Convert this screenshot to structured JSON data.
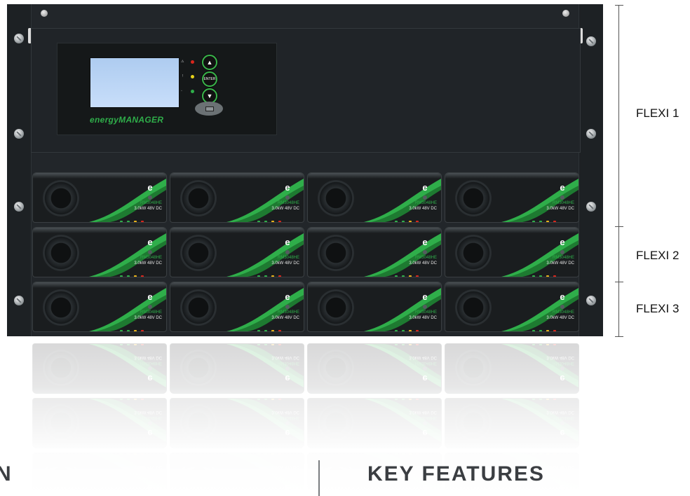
{
  "controller": {
    "brand": "energyMANAGER",
    "nav_buttons": [
      "▲",
      "ENTER",
      "▼"
    ],
    "led_labels": [
      "",
      "",
      ""
    ]
  },
  "modules": [
    {
      "model": "RM3048HE",
      "rating": "3.0kW 48V DC"
    },
    {
      "model": "RM3048HE",
      "rating": "3.0kW 48V DC"
    },
    {
      "model": "RM3048HE",
      "rating": "3.0kW 48V DC"
    },
    {
      "model": "RM3048HE",
      "rating": "3.0kW 48V DC"
    },
    {
      "model": "RM3048HE",
      "rating": "3.0kW 48V DC"
    },
    {
      "model": "RM3048HE",
      "rating": "3.0kW 48V DC"
    },
    {
      "model": "RM3048HE",
      "rating": "3.0kW 48V DC"
    },
    {
      "model": "RM3048HE",
      "rating": "3.0kW 48V DC"
    },
    {
      "model": "RM3048HE",
      "rating": "3.0kW 48V DC"
    },
    {
      "model": "RM3048HE",
      "rating": "3.0kW 48V DC"
    },
    {
      "model": "RM3048HE",
      "rating": "3.0kW 48V DC"
    },
    {
      "model": "RM3048HE",
      "rating": "3.0kW 48V DC"
    }
  ],
  "labels": {
    "flexi1": "FLEXI 1",
    "flexi2": "FLEXI 2",
    "flexi3": "FLEXI 3"
  },
  "headings": {
    "left_partial": "N",
    "right": "KEY FEATURES"
  },
  "colors": {
    "accent_green": "#2fae4a",
    "rack": "#22262a",
    "heading": "#3b3e42"
  }
}
